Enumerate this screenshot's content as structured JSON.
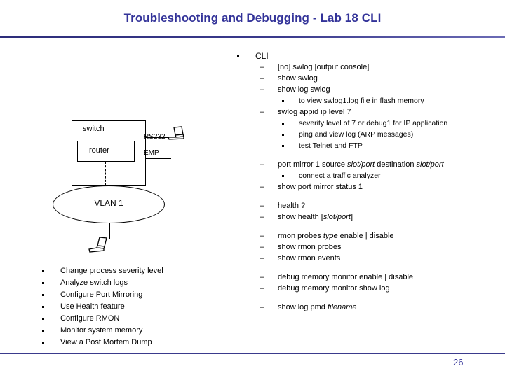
{
  "slide": {
    "title": "Troubleshooting and Debugging - Lab 18 CLI",
    "page_number": "26",
    "accent_color": "#333399",
    "rule_color": "#3a3a8c"
  },
  "diagram": {
    "switch_label": "switch",
    "router_label": "router",
    "rs232_label": "RS232",
    "emp_label": "EMP",
    "vlan_label": "VLAN 1",
    "console_icon": "laptop-icon",
    "host_icon": "laptop-icon"
  },
  "objectives": [
    "Change process severity level",
    "Analyze switch logs",
    "Configure Port Mirroring",
    "Use Health feature",
    "Configure RMON",
    "Monitor system memory",
    "View a Post Mortem Dump"
  ],
  "cli": {
    "dash": "–",
    "rows": [
      {
        "level": 1,
        "text": "CLI"
      },
      {
        "level": 2,
        "text": "[no] swlog [output console]"
      },
      {
        "level": 2,
        "text": "show swlog"
      },
      {
        "level": 2,
        "text": "show log swlog"
      },
      {
        "level": 3,
        "text": "to view swlog1.log file in flash memory"
      },
      {
        "level": 2,
        "text": "swlog appid ip level 7"
      },
      {
        "level": 3,
        "text": "severity level of 7 or debug1 for IP application"
      },
      {
        "level": 3,
        "text": "ping and view log (ARP messages)"
      },
      {
        "level": 3,
        "text": "test Telnet and FTP"
      },
      {
        "level": 0,
        "text": ""
      },
      {
        "level": 2,
        "text": "port mirror 1 source slot/port destination slot/port",
        "italic_parts": [
          "slot/port",
          "slot/port"
        ]
      },
      {
        "level": 3,
        "text": "connect a traffic analyzer"
      },
      {
        "level": 2,
        "text": "show port mirror status 1"
      },
      {
        "level": 0,
        "text": ""
      },
      {
        "level": 2,
        "text": "health ?"
      },
      {
        "level": 2,
        "text": "show health [slot/port]",
        "italic_parts": [
          "slot/port"
        ]
      },
      {
        "level": 0,
        "text": ""
      },
      {
        "level": 2,
        "text": "rmon probes type enable | disable",
        "italic_parts": [
          "type"
        ]
      },
      {
        "level": 2,
        "text": "show rmon probes"
      },
      {
        "level": 2,
        "text": "show rmon events"
      },
      {
        "level": 0,
        "text": ""
      },
      {
        "level": 2,
        "text": "debug memory monitor enable | disable"
      },
      {
        "level": 2,
        "text": "debug memory monitor show log"
      },
      {
        "level": 0,
        "text": ""
      },
      {
        "level": 2,
        "text": "show log pmd filename",
        "italic_parts": [
          "filename"
        ]
      }
    ]
  }
}
